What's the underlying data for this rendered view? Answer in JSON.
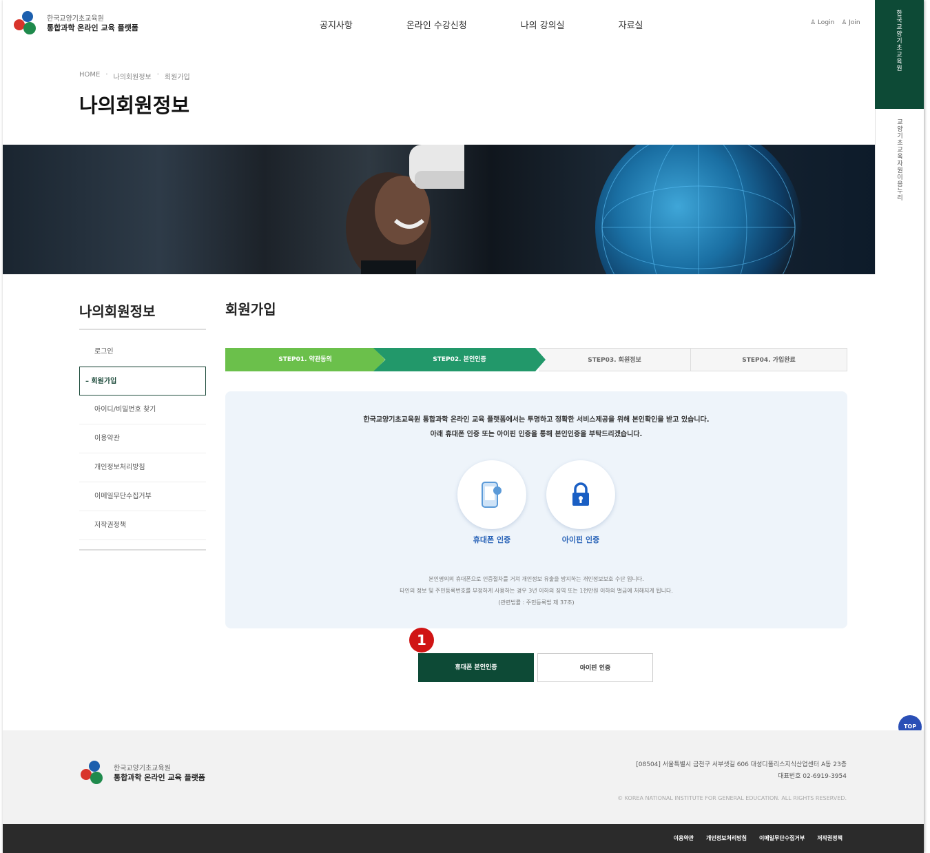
{
  "header": {
    "logo_line1": "한국교양기초교육원",
    "logo_line2": "통합과학 온라인 교육 플랫폼",
    "nav": [
      "공지사항",
      "온라인 수강신청",
      "나의 강의실",
      "자료실"
    ],
    "util_login": "Login",
    "util_join": "Join"
  },
  "side_tabs": {
    "tab1": "한국교양기초교육원",
    "tab2": "교양기초교육자원이음누리"
  },
  "breadcrumb": [
    "HOME",
    "나의회원정보",
    "회원가입"
  ],
  "page_title": "나의회원정보",
  "sidebar": {
    "title": "나의회원정보",
    "items": [
      {
        "label": "로그인"
      },
      {
        "label": "회원가입"
      },
      {
        "label": "아이디/비밀번호 찾기"
      },
      {
        "label": "이용약관"
      },
      {
        "label": "개인정보처리방침"
      },
      {
        "label": "이메일무단수집거부"
      },
      {
        "label": "저작권정책"
      }
    ]
  },
  "content": {
    "title": "회원가입",
    "steps": [
      "STEP01. 약관동의",
      "STEP02. 본인인증",
      "STEP03. 회원정보",
      "STEP04. 가입완료"
    ],
    "desc_line1": "한국교양기초교육원 통합과학 온라인 교육 플랫폼에서는 투명하고 정확한 서비스제공을 위해 본인확인을 받고 있습니다.",
    "desc_line2": "아래 휴대폰 인증 또는 아이핀 인증을 통해 본인인증을 부탁드리겠습니다.",
    "phone_label": "휴대폰 인증",
    "ipin_label": "아이핀 인증",
    "legal_line1": "본인명의의 휴대폰으로 인증절차를 거쳐 개인정보 유출을 방지하는 개인정보보호 수단 입니다.",
    "legal_line2": "타인의 정보 및 주민등록번호를 부정하게 사용하는 경우 3년 이하의 징역 또는 1천만원 이하의 벌금에 처해지게 됩니다.",
    "legal_line3": "(관련법률 : 주민등록법 제 37조)",
    "badge": "1",
    "btn_phone": "휴대폰 본인인증",
    "btn_ipin": "아이핀 인증",
    "top": "TOP"
  },
  "footer": {
    "logo_line1": "한국교양기초교육원",
    "logo_line2": "통합과학 온라인 교육 플랫폼",
    "address": "[08504] 서울특별시 금천구 서부샛길 606 대성디폴리스지식산업센터 A동 23층",
    "phone": "대표번호 02-6919-3954",
    "copyright": "© KOREA NATIONAL INSTITUTE FOR GENERAL EDUCATION. ALL RIGHTS RESERVED.",
    "links": [
      "이용약관",
      "개인정보처리방침",
      "이메일무단수집거부",
      "저작권정책"
    ]
  },
  "colors": {
    "brand_dark_green": "#0d4a36",
    "step_light_green": "#6bc04b",
    "step_green": "#22986a",
    "accent_blue": "#2a64b8",
    "badge_red": "#d01414"
  }
}
